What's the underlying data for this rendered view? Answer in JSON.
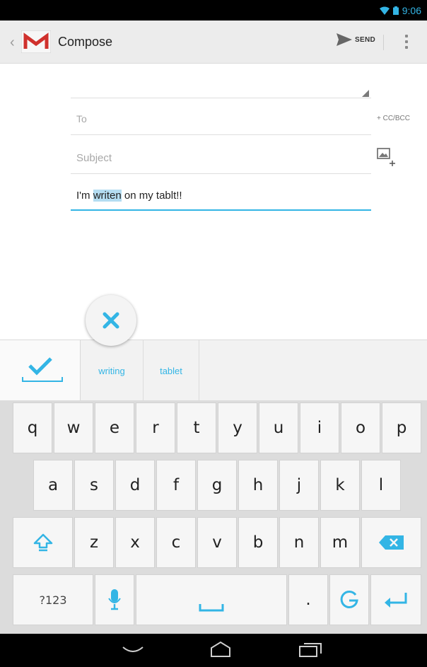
{
  "status_bar": {
    "time": "9:06"
  },
  "action_bar": {
    "title": "Compose",
    "send_label": "SEND"
  },
  "compose": {
    "to_placeholder": "To",
    "cc_bcc_label": "+ CC/BCC",
    "subject_placeholder": "Subject",
    "body_before": "I'm ",
    "body_selected": "writen",
    "body_after": " on my tablt!!"
  },
  "suggestions": [
    "writing",
    "tablet"
  ],
  "keyboard": {
    "row1": [
      "q",
      "w",
      "e",
      "r",
      "t",
      "y",
      "u",
      "i",
      "o",
      "p"
    ],
    "row2": [
      "a",
      "s",
      "d",
      "f",
      "g",
      "h",
      "j",
      "k",
      "l"
    ],
    "row3": [
      "z",
      "x",
      "c",
      "v",
      "b",
      "n",
      "m"
    ],
    "symbols_label": "?123",
    "period_label": "."
  },
  "colors": {
    "accent": "#33b5e5",
    "gmail_red": "#d0312d"
  },
  "icons": [
    "gmail-logo",
    "send-icon",
    "overflow-menu-icon",
    "attach-image-icon",
    "close-icon",
    "checkmark-icon",
    "shift-icon",
    "delete-icon",
    "mic-icon",
    "space-icon",
    "google-icon",
    "enter-icon",
    "back-nav-icon",
    "home-nav-icon",
    "recent-apps-icon"
  ]
}
